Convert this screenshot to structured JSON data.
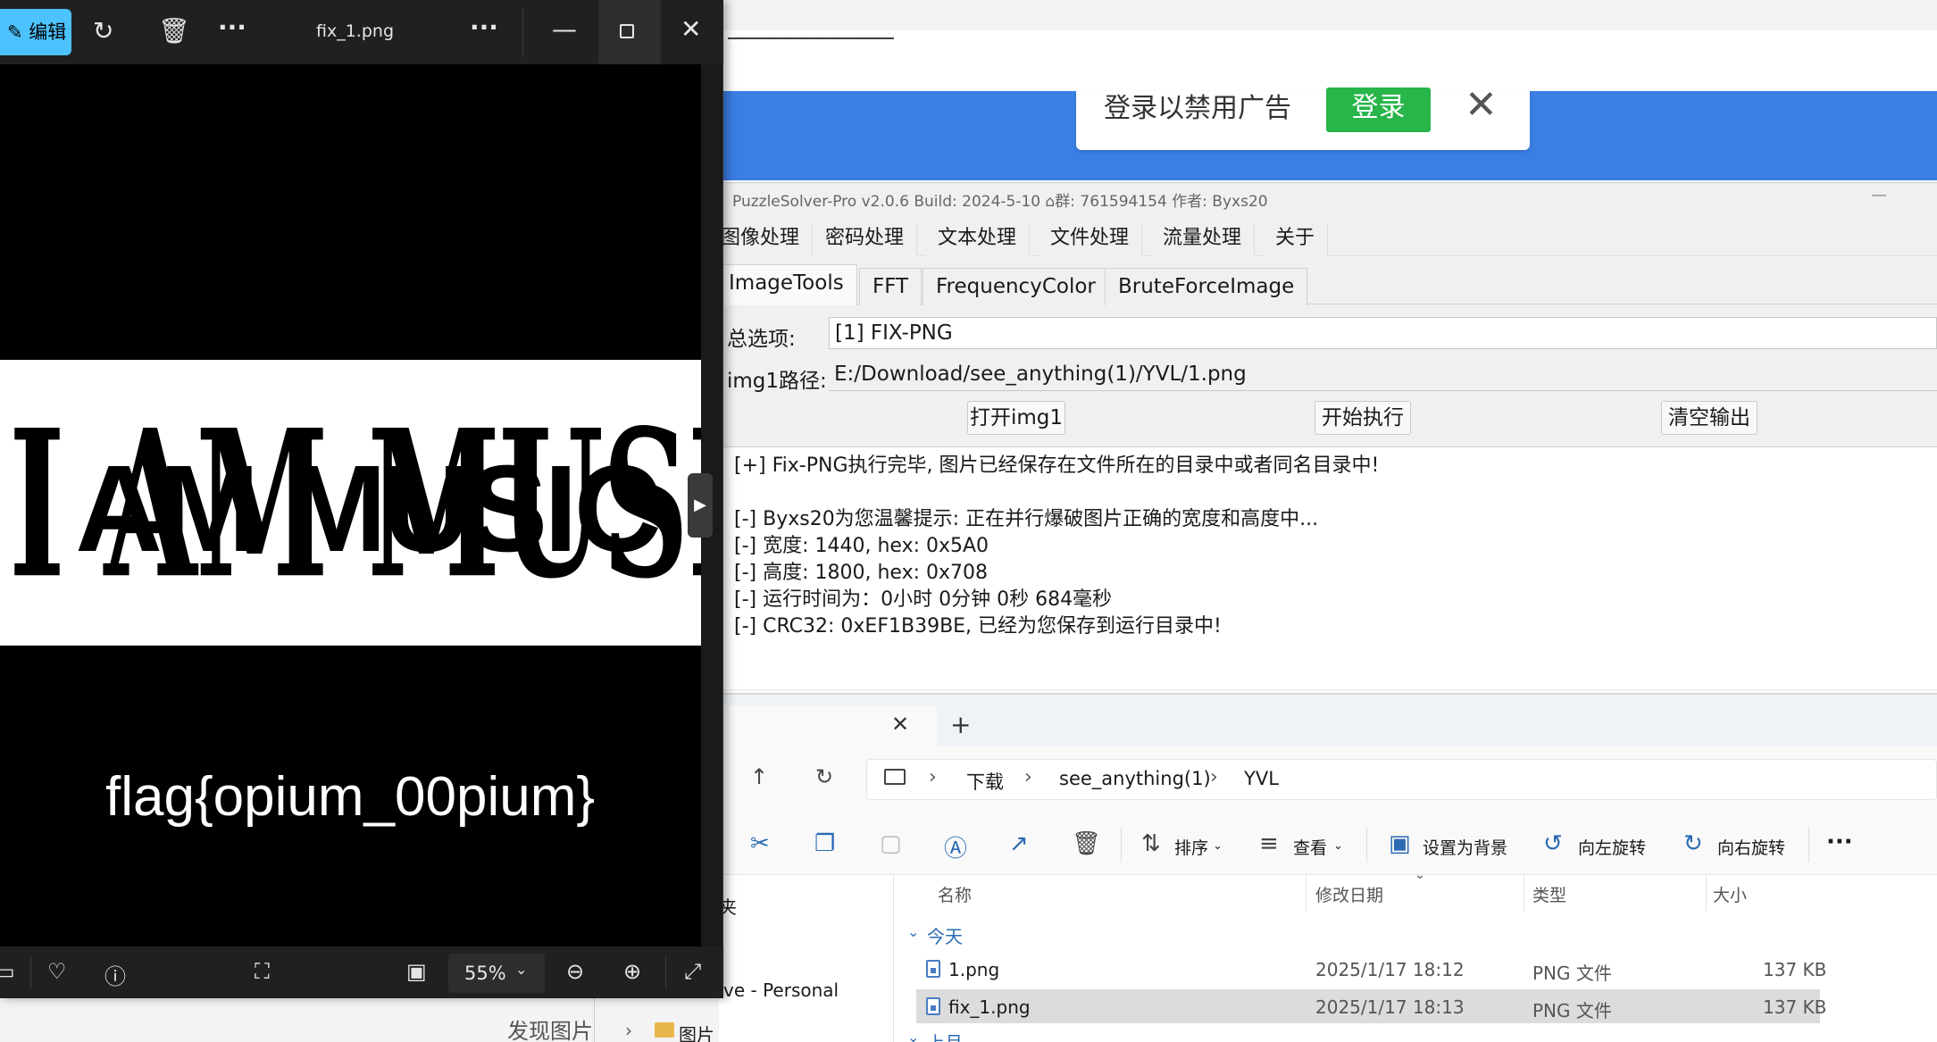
{
  "browser": {
    "ad_text": "登录以禁用广告",
    "ad_login": "登录",
    "ad_close": "✕"
  },
  "puzzlesolver": {
    "title": "PuzzleSolver-Pro v2.0.6 Build: 2024-5-10 ⌂群: 761594154 作者: Byxs20",
    "minimize": "—",
    "menu": [
      "图像处理",
      "密码处理",
      "文本处理",
      "文件处理",
      "流量处理",
      "关于"
    ],
    "tabs": [
      "ImageTools",
      "FFT",
      "FrequencyColor",
      "BruteForceImage"
    ],
    "option_label": "总选项:",
    "option_value": "[1] FIX-PNG",
    "path_label": "img1路径:",
    "path_value": "E:/Download/see_anything(1)/YVL/1.png",
    "buttons": {
      "open": "打开img1",
      "run": "开始执行",
      "clear": "清空输出"
    },
    "output": [
      "[+] Fix-PNG执行完毕, 图片已经保存在文件所在的目录中或者同名目录中!",
      "",
      "[-] Byxs20为您温馨提示: 正在并行爆破图片正确的宽度和高度中...",
      "[-] 宽度: 1440, hex: 0x5A0",
      "[-] 高度: 1800, hex: 0x708",
      "[-] 运行时间为：0小时 0分钟 0秒 684毫秒",
      "[-] CRC32: 0xEF1B39BE, 已经为您保存到运行目录中!"
    ]
  },
  "explorer": {
    "tab_close": "✕",
    "new_tab": "+",
    "breadcrumb": [
      "下载",
      "see_anything(1)",
      "YVL"
    ],
    "toolbar": {
      "sort": "排序",
      "view": "查看",
      "set_bg": "设置为背景",
      "rotate_left": "向左旋转",
      "rotate_right": "向右旋转",
      "more": "···"
    },
    "columns": {
      "name": "名称",
      "date": "修改日期",
      "type": "类型",
      "size": "大小"
    },
    "group_today": "今天",
    "group_earlier": "上月",
    "files": [
      {
        "name": "1.png",
        "date": "2025/1/17 18:12",
        "type": "PNG 文件",
        "size": "137 KB"
      },
      {
        "name": "fix_1.png",
        "date": "2025/1/17 18:13",
        "type": "PNG 文件",
        "size": "137 KB"
      }
    ],
    "nav_onedrive": "ve - Personal",
    "nav_pictures": "图片",
    "nav_fragment": "夹"
  },
  "behind": {
    "discover_text": "发现图片"
  },
  "photos": {
    "edit_label": "编辑",
    "filename": "fix_1.png",
    "more": "···",
    "image_text_serif": "I AM MUSIC",
    "image_text_sans": "I AM MUSIC",
    "flag_text": "flag{opium_00pium}",
    "zoom": "55%"
  }
}
